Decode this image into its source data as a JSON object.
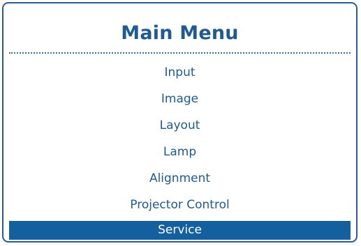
{
  "menu": {
    "title": "Main Menu",
    "items": [
      {
        "label": "Input"
      },
      {
        "label": "Image"
      },
      {
        "label": "Layout"
      },
      {
        "label": "Lamp"
      },
      {
        "label": "Alignment"
      },
      {
        "label": "Projector Control"
      },
      {
        "label": "Service",
        "selected": true
      }
    ]
  },
  "colors": {
    "accent": "#1f5a90",
    "selected_background": "#14609e",
    "border": "#2c5a92"
  }
}
